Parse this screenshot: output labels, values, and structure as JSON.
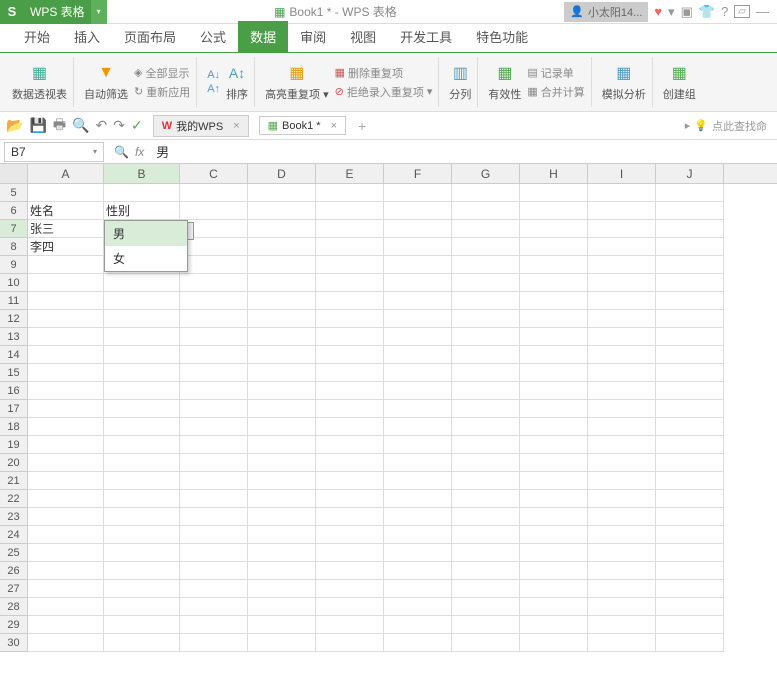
{
  "app": {
    "logo": "S",
    "name": "WPS 表格",
    "title_doc": "Book1 * - WPS 表格"
  },
  "user": {
    "name": "小太阳14..."
  },
  "menu": [
    "开始",
    "插入",
    "页面布局",
    "公式",
    "数据",
    "审阅",
    "视图",
    "开发工具",
    "特色功能"
  ],
  "menu_active": 4,
  "ribbon": {
    "pivot": "数据透视表",
    "autofilter": "自动筛选",
    "showall": "全部显示",
    "reapply": "重新应用",
    "sort": "排序",
    "highlight": "高亮重复项",
    "removedup": "删除重复项",
    "reject": "拒绝录入重复项",
    "split": "分列",
    "validity": "有效性",
    "record": "记录单",
    "consolidate": "合并计算",
    "whatif": "模拟分析",
    "group": "创建组"
  },
  "doc_tabs": {
    "wps": "我的WPS",
    "book": "Book1 *"
  },
  "search_hint": "点此查找命",
  "name_box": "B7",
  "formula": "男",
  "columns": [
    "A",
    "B",
    "C",
    "D",
    "E",
    "F",
    "G",
    "H",
    "I",
    "J"
  ],
  "rows_start": 5,
  "rows_end": 30,
  "cells": {
    "A6": "姓名",
    "B6": "性别",
    "A7": "张三",
    "B7": "男",
    "A8": "李四"
  },
  "dropdown": {
    "items": [
      "男",
      "女"
    ],
    "hover": 0
  }
}
